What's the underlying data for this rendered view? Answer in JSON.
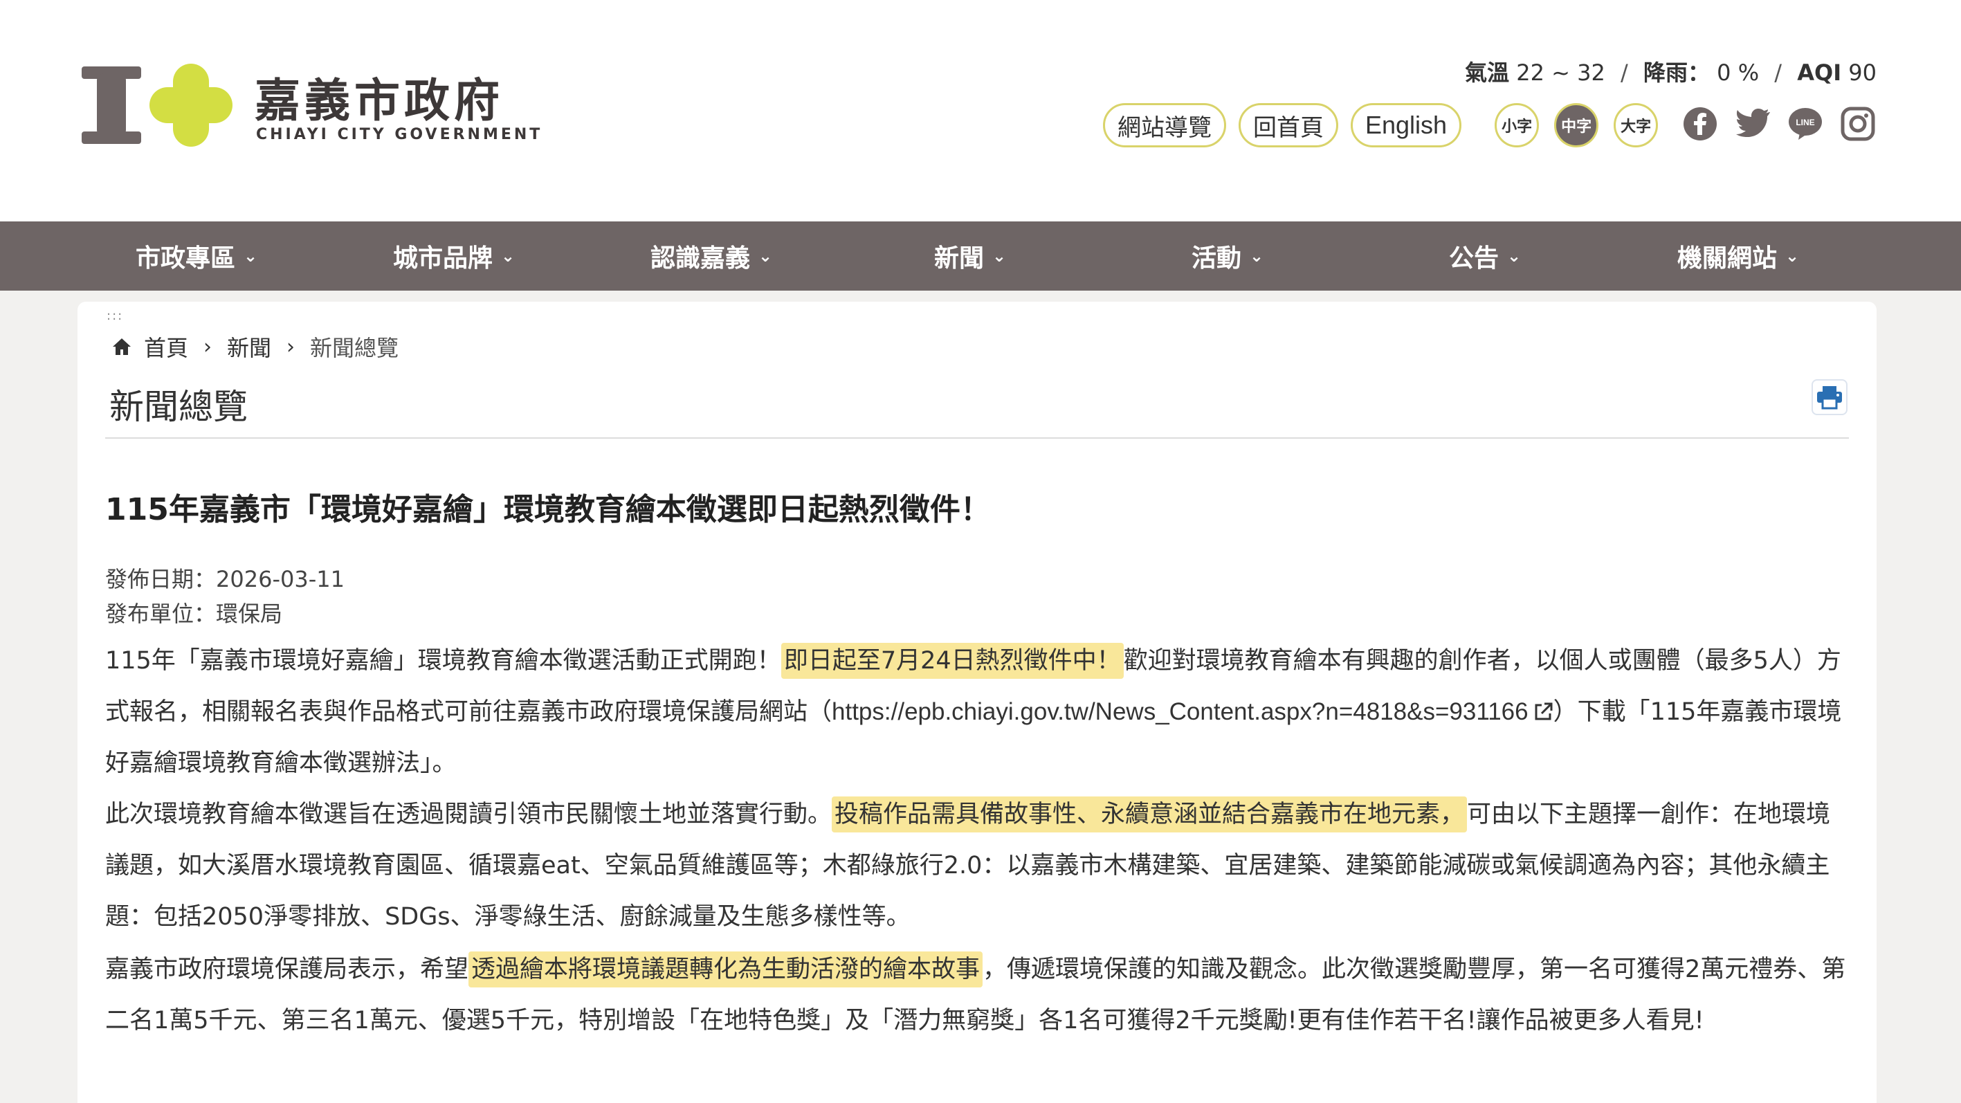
{
  "header": {
    "brand_title": "嘉義市政府",
    "brand_subtitle": "CHIAYI CITY GOVERNMENT",
    "weather": {
      "temp_label": "氣溫",
      "temp_value": "22 ~ 32",
      "rain_label": "降雨：",
      "rain_value": "0 %",
      "aqi_label": "AQI",
      "aqi_value": "90",
      "separator": "/"
    },
    "links": {
      "sitemap": "網站導覽",
      "home": "回首頁",
      "english": "English"
    },
    "font_sizes": {
      "small": "小字",
      "medium": "中字",
      "large": "大字"
    },
    "social_icons": [
      "facebook-icon",
      "twitter-icon",
      "line-icon",
      "instagram-icon"
    ]
  },
  "nav": {
    "items": [
      "市政專區",
      "城市品牌",
      "認識嘉義",
      "新聞",
      "活動",
      "公告",
      "機關網站"
    ],
    "chevron": "⌄"
  },
  "content": {
    "dots": ":::",
    "breadcrumb": {
      "home": "首頁",
      "level2": "新聞",
      "current": "新聞總覽",
      "separator": "›"
    },
    "page_title": "新聞總覽",
    "article": {
      "title": "115年嘉義市「環境好嘉繪」環境教育繪本徵選即日起熱烈徵件！",
      "date": "發佈日期：2026-03-11",
      "unit": "發布單位：環保局",
      "p1_a": "115年「嘉義市環境好嘉繪」環境教育繪本徵選活動正式開跑！",
      "p1_hl": "即日起至7月24日熱烈徵件中！",
      "p1_b": "歡迎對環境教育繪本有興趣的創作者，以個人或團體（最多5人）方式報名，相關報名表與作品格式可前往嘉義市政府環境保護局網站（",
      "p1_link": "https://epb.chiayi.gov.tw/News_Content.aspx?n=4818&s=931166",
      "p1_c": "）下載「115年嘉義市環境好嘉繪環境教育繪本徵選辦法」。",
      "p2_a": "此次環境教育繪本徵選旨在透過閱讀引領市民關懷土地並落實行動。",
      "p2_hl": "投稿作品需具備故事性、永續意涵並結合嘉義市在地元素，",
      "p2_b": "可由以下主題擇一創作：在地環境議題，如大溪厝水環境教育園區、循環嘉eat、空氣品質維護區等；木都綠旅行2.0：以嘉義市木構建築、宜居建築、建築節能減碳或氣候調適為內容；其他永續主題：包括2050淨零排放、SDGs、淨零綠生活、廚餘減量及生態多樣性等。",
      "p3_a": "嘉義市政府環境保護局表示，希望",
      "p3_hl": "透過繪本將環境議題轉化為生動活潑的繪本故事",
      "p3_b": "，傳遞環境保護的知識及觀念。此次徵選獎勵豐厚，第一名可獲得2萬元禮券、第二名1萬5千元、第三名1萬元、優選5千元，特別增設「在地特色獎」及「潛力無窮獎」各1名可獲得2千元獎勵!更有佳作若干名!讓作品被更多人看見!"
    }
  },
  "colors": {
    "nav_bg": "#6e6565",
    "accent_yellow": "#d3de43",
    "highlight": "#f9e79a",
    "pill_border": "#d9d36a"
  }
}
